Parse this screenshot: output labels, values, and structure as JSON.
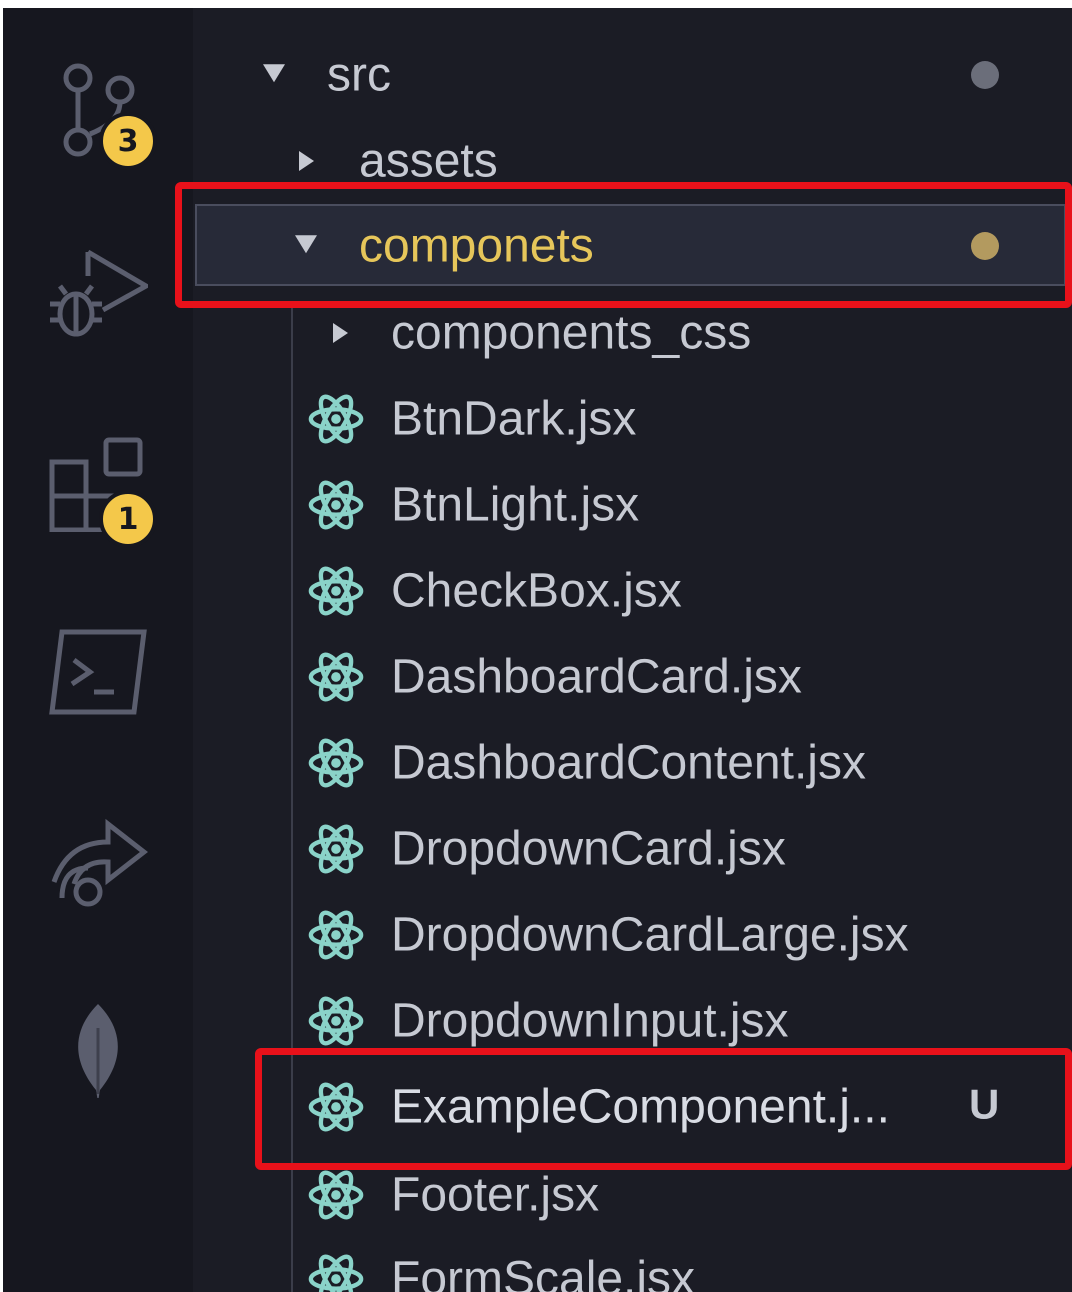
{
  "activity_bar": {
    "items": [
      {
        "icon": "source-control-icon",
        "badge": "3"
      },
      {
        "icon": "run-debug-icon",
        "badge": ""
      },
      {
        "icon": "extensions-icon",
        "badge": "1"
      },
      {
        "icon": "terminal-icon",
        "badge": ""
      },
      {
        "icon": "remote-share-icon",
        "badge": ""
      },
      {
        "icon": "mongodb-leaf-icon",
        "badge": ""
      }
    ]
  },
  "explorer": {
    "folders": {
      "src": "src",
      "assets": "assets",
      "componets": "componets",
      "components_css": "components_css"
    },
    "files": [
      "BtnDark.jsx",
      "BtnLight.jsx",
      "CheckBox.jsx",
      "DashboardCard.jsx",
      "DashboardContent.jsx",
      "DropdownCard.jsx",
      "DropdownCardLarge.jsx",
      "DropdownInput.jsx",
      "ExampleComponent.j...",
      "Footer.jsx",
      "FormScale.jsx"
    ],
    "example_status": "U"
  },
  "colors": {
    "highlight_red": "#e8111a",
    "modified_folder": "#e6c65a",
    "modified_dot": "#b39a5f",
    "react_icon": "#8ad3c9"
  }
}
